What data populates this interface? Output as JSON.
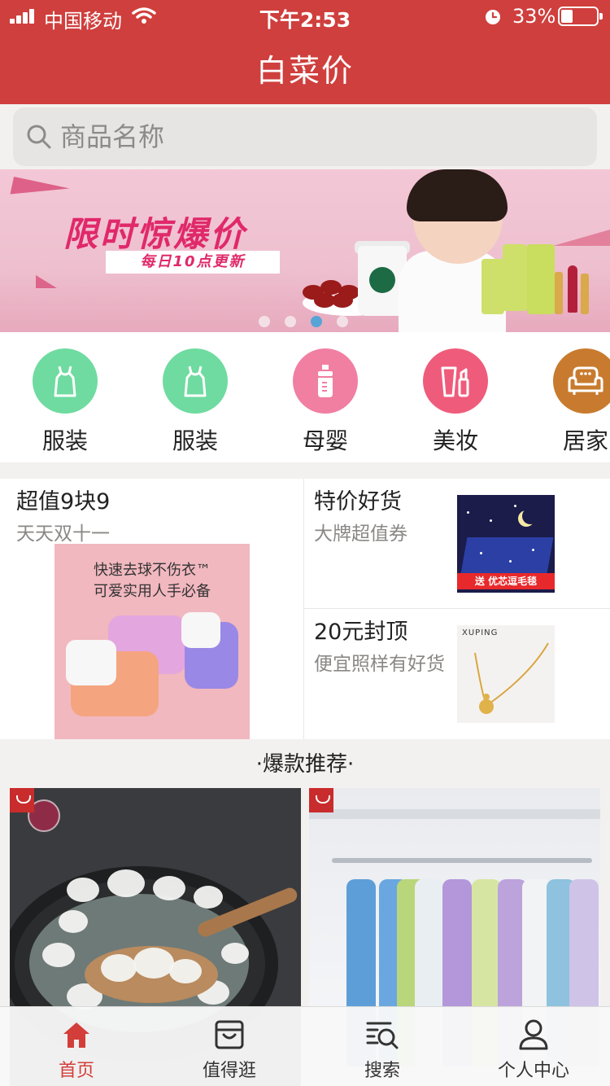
{
  "status_bar": {
    "carrier": "中国移动",
    "time": "下午2:53",
    "battery": "33%",
    "battery_level": 0.33
  },
  "header": {
    "title": "白菜价"
  },
  "search": {
    "placeholder": "商品名称",
    "value": ""
  },
  "banner": {
    "title": "限时惊爆价",
    "subtitle": "每日10点更新",
    "slide_count": 4,
    "active_slide": 3
  },
  "categories": [
    {
      "label": "服装",
      "icon": "dress-icon",
      "color": "#6fdba0"
    },
    {
      "label": "服装",
      "icon": "dress-icon",
      "color": "#6fdba0"
    },
    {
      "label": "母婴",
      "icon": "baby-bottle-icon",
      "color": "#f07fa1"
    },
    {
      "label": "美妆",
      "icon": "cosmetics-icon",
      "color": "#ef5c7b"
    },
    {
      "label": "居家",
      "icon": "sofa-icon",
      "color": "#c87b2e"
    }
  ],
  "promos": {
    "left": {
      "title": "超值9块9",
      "subtitle": "天天双十一",
      "image_text_line1": "快速去球不伤衣™",
      "image_text_line2": "可爱实用人手必备"
    },
    "top_right": {
      "title": "特价好货",
      "subtitle": "大牌超值券",
      "image_tag": "送 优芯逗毛毯"
    },
    "bottom_right": {
      "title": "20元封顶",
      "subtitle": "便宜照样有好货",
      "image_brand": "XUPING"
    }
  },
  "section": {
    "title": "·爆款推荐·"
  },
  "tabbar": [
    {
      "label": "首页",
      "icon": "home-icon",
      "active": true
    },
    {
      "label": "值得逛",
      "icon": "shopping-bag-icon",
      "active": false
    },
    {
      "label": "搜索",
      "icon": "search-list-icon",
      "active": false
    },
    {
      "label": "个人中心",
      "icon": "user-icon",
      "active": false
    }
  ],
  "colors": {
    "brand_red": "#cf3f3d",
    "active_tab": "#d33e3a",
    "dot_active": "#47a3d8"
  }
}
